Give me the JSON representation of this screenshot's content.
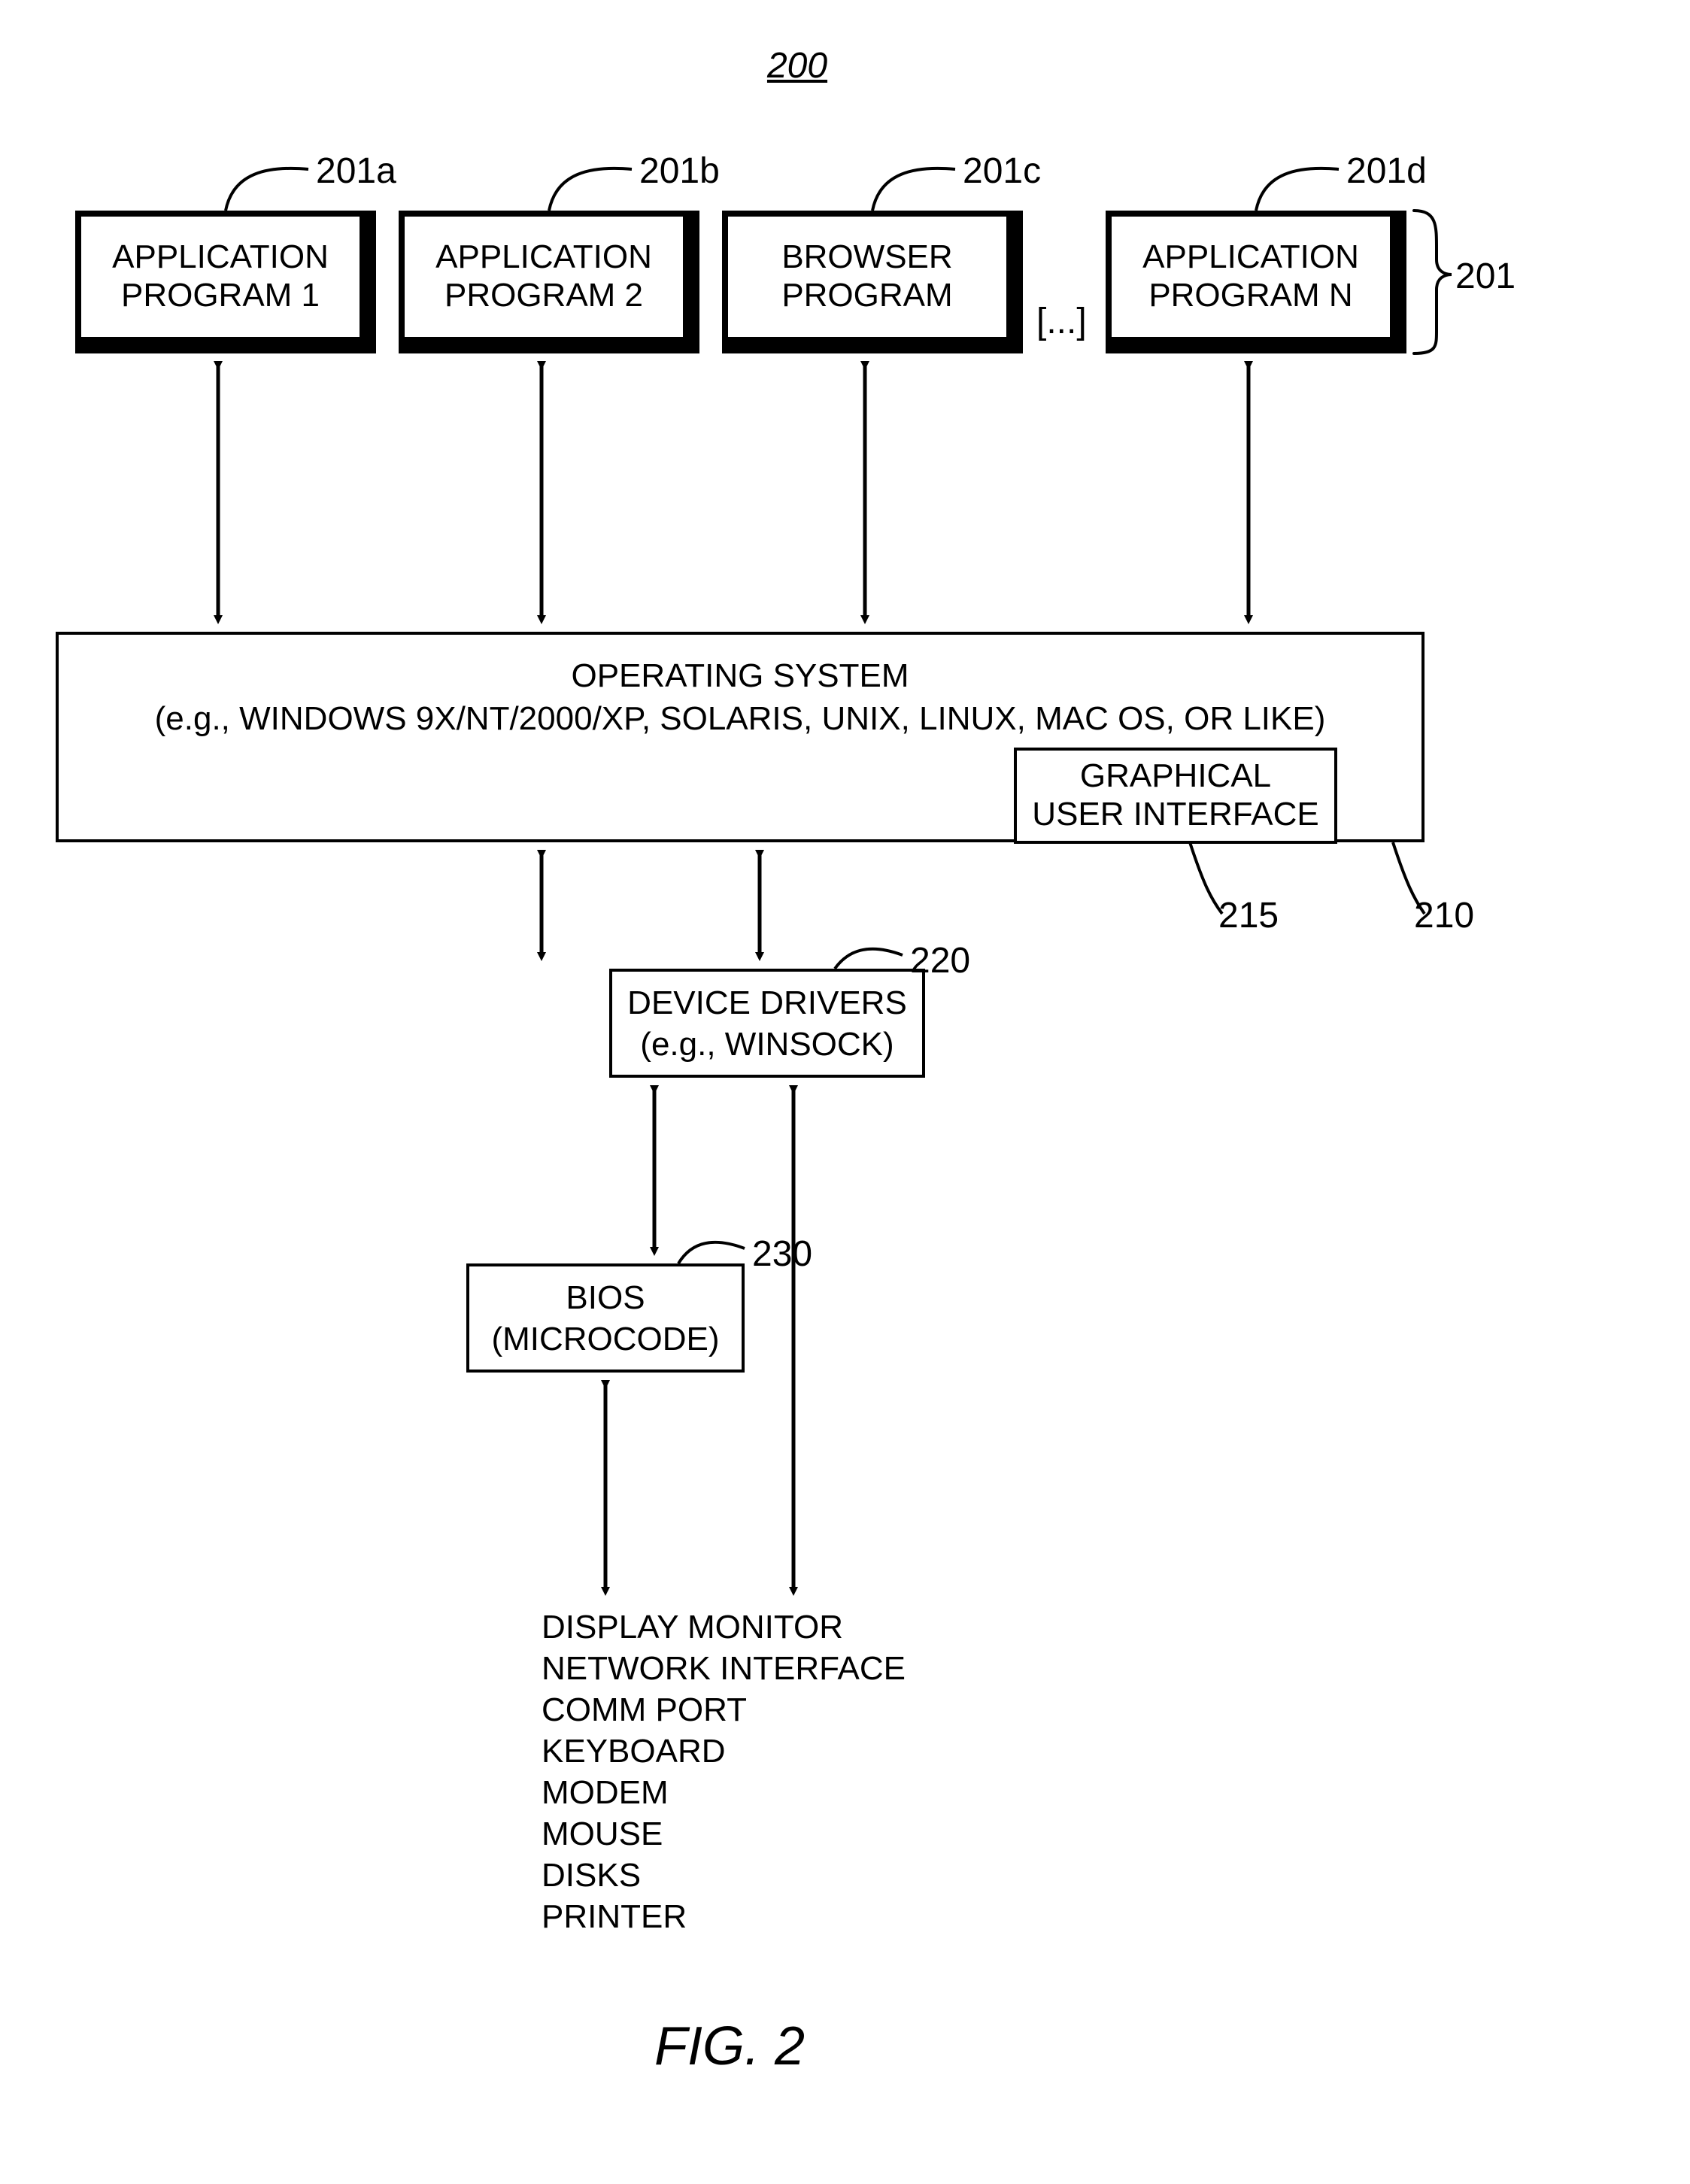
{
  "figure": {
    "number_ref": "200",
    "caption": "FIG. 2",
    "group_ref_201": "201"
  },
  "apps": {
    "a": {
      "ref": "201a",
      "line1": "APPLICATION",
      "line2": "PROGRAM 1"
    },
    "b": {
      "ref": "201b",
      "line1": "APPLICATION",
      "line2": "PROGRAM 2"
    },
    "c": {
      "ref": "201c",
      "line1": "BROWSER",
      "line2": "PROGRAM"
    },
    "d": {
      "ref": "201d",
      "line1": "APPLICATION",
      "line2": "PROGRAM N"
    }
  },
  "ellipsis": "[...]",
  "os": {
    "line1": "OPERATING SYSTEM",
    "line2": "(e.g., WINDOWS 9X/NT/2000/XP, SOLARIS, UNIX, LINUX, MAC OS, OR LIKE)",
    "ref": "210"
  },
  "gui": {
    "line1": "GRAPHICAL",
    "line2": "USER INTERFACE",
    "ref": "215"
  },
  "drivers": {
    "line1": "DEVICE DRIVERS",
    "line2": "(e.g., WINSOCK)",
    "ref": "220"
  },
  "bios": {
    "line1": "BIOS",
    "line2": "(MICROCODE)",
    "ref": "230"
  },
  "hardware": {
    "l1": "DISPLAY MONITOR",
    "l2": "NETWORK INTERFACE",
    "l3": "COMM PORT",
    "l4": "KEYBOARD",
    "l5": "MODEM",
    "l6": "MOUSE",
    "l7": "DISKS",
    "l8": "PRINTER"
  }
}
